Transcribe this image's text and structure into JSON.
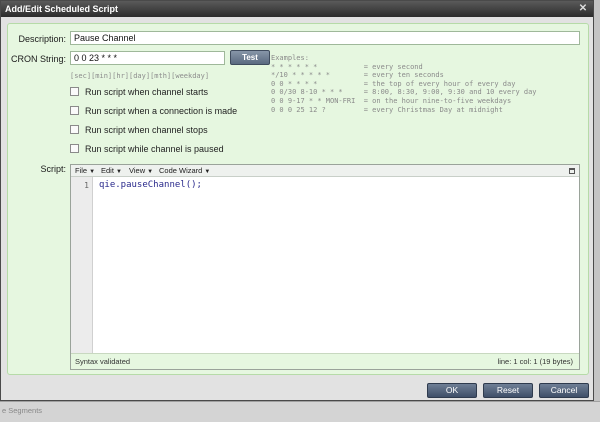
{
  "window": {
    "title": "Add/Edit Scheduled Script"
  },
  "form": {
    "description_label": "Description:",
    "description_value": "Pause Channel",
    "cron_label": "CRON String:",
    "cron_value": "0 0 23 * * *",
    "test_button": "Test",
    "cron_hint": "[sec][min][hr][day][mth][weekday]",
    "checks": [
      {
        "label": "Run script when channel starts",
        "checked": false
      },
      {
        "label": "Run script when a connection is made",
        "checked": false
      },
      {
        "label": "Run script when channel stops",
        "checked": false
      },
      {
        "label": "Run script while channel is paused",
        "checked": false
      }
    ],
    "script_label": "Script:"
  },
  "examples": {
    "header": "Examples:",
    "rows": [
      {
        "expr": "* * * * * *",
        "desc": "= every second"
      },
      {
        "expr": "*/10 * * * * *",
        "desc": "= every ten seconds"
      },
      {
        "expr": "0 0 * * * *",
        "desc": "= the top of every hour of every day"
      },
      {
        "expr": "0 0/30 8-10 * * *",
        "desc": "= 8:00, 8:30, 9:00, 9:30 and 10 every day"
      },
      {
        "expr": "0 0 9-17 * * MON-FRI",
        "desc": "= on the hour nine-to-five weekdays"
      },
      {
        "expr": "0 0 0 25 12 ?",
        "desc": "= every Christmas Day at midnight"
      }
    ]
  },
  "editor": {
    "menu": [
      "File",
      "Edit",
      "View",
      "Code Wizard"
    ],
    "line_number": "1",
    "code": "qie.pauseChannel();",
    "status_left": "Syntax validated",
    "status_right": "line: 1  col: 1  (19 bytes)"
  },
  "buttons": {
    "ok": "OK",
    "reset": "Reset",
    "cancel": "Cancel"
  },
  "background": {
    "text": "e Segments"
  },
  "colors": {
    "panel": "#e6f7e0",
    "button": "#4f5f78",
    "titlebar": "#2c2c2c"
  }
}
